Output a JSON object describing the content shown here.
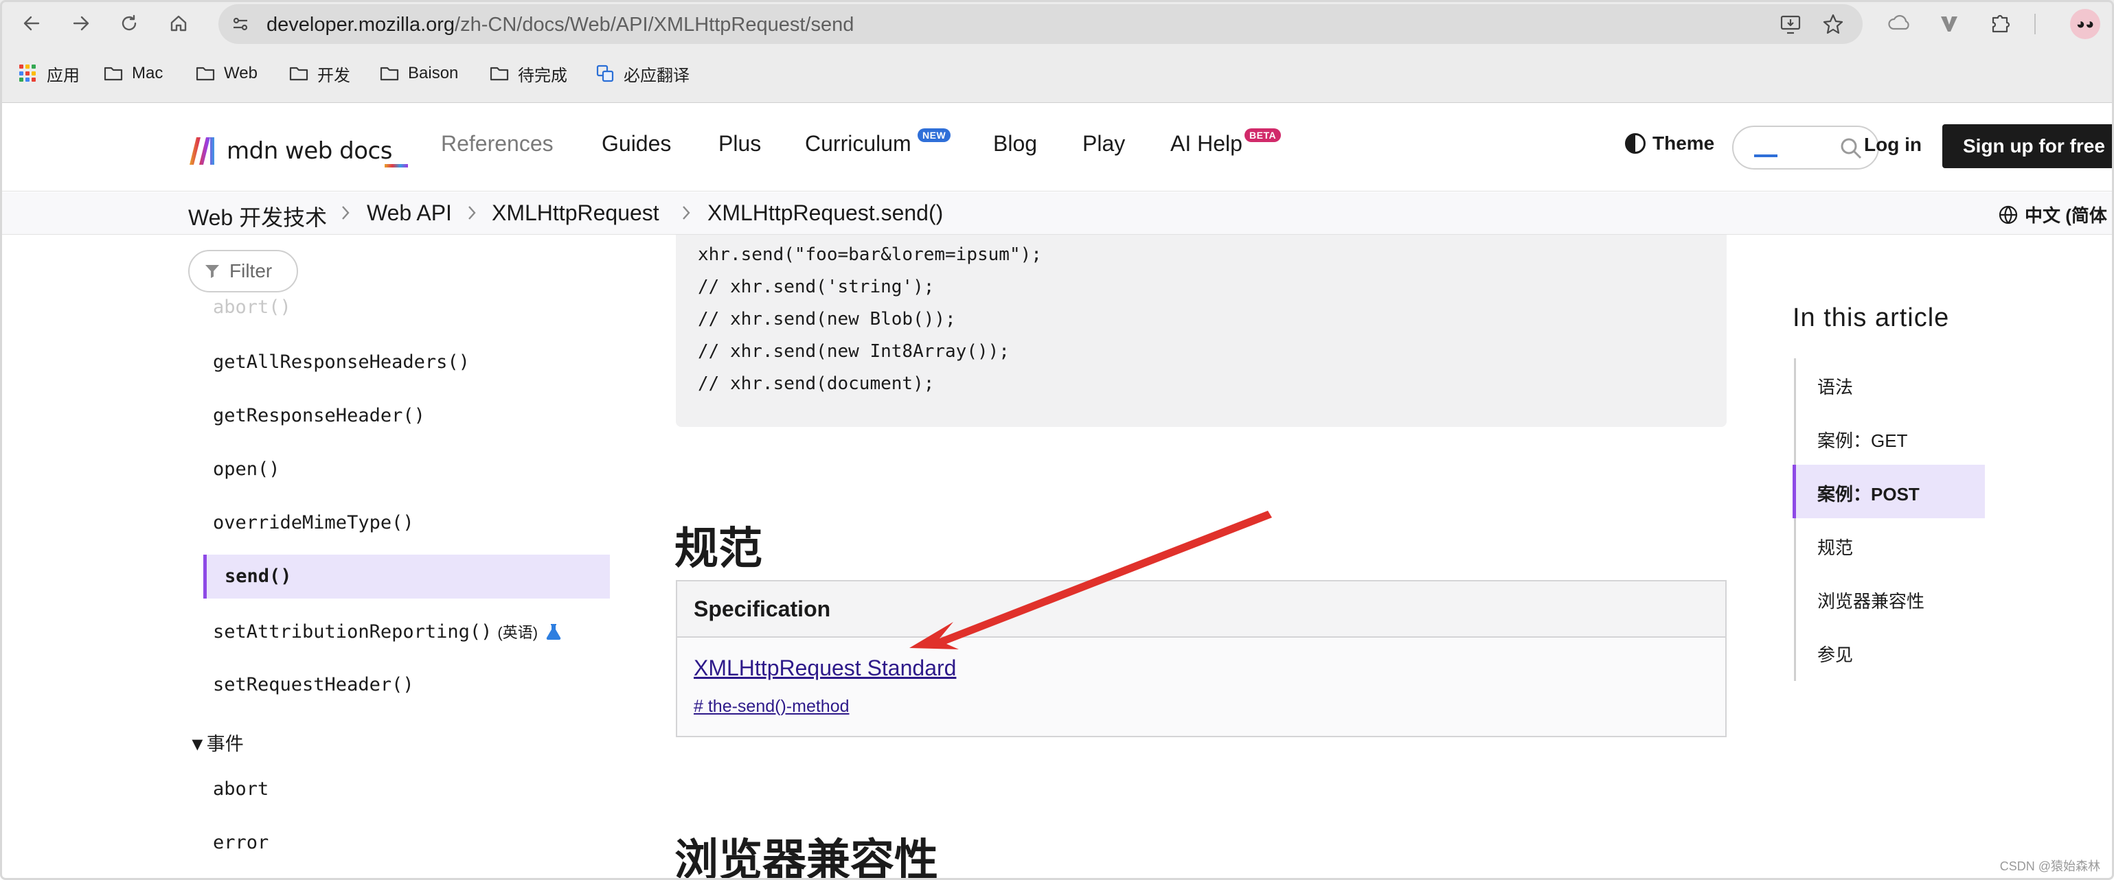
{
  "browser": {
    "url_host": "developer.mozilla.org",
    "url_path": "/zh-CN/docs/Web/API/XMLHttpRequest/send",
    "bookmarks": [
      {
        "label": "应用",
        "icon": "apps-grid-icon"
      },
      {
        "label": "Mac",
        "icon": "folder-icon"
      },
      {
        "label": "Web",
        "icon": "folder-icon"
      },
      {
        "label": "开发",
        "icon": "folder-icon"
      },
      {
        "label": "Baison",
        "icon": "folder-icon"
      },
      {
        "label": "待完成",
        "icon": "folder-icon"
      },
      {
        "label": "必应翻译",
        "icon": "bing-translate-icon"
      }
    ]
  },
  "header": {
    "logo_text": "mdn web docs",
    "nav": [
      {
        "label": "References"
      },
      {
        "label": "Guides"
      },
      {
        "label": "Plus"
      },
      {
        "label": "Curriculum",
        "tag": "NEW"
      },
      {
        "label": "Blog"
      },
      {
        "label": "Play"
      },
      {
        "label": "AI Help",
        "tag": "BETA"
      }
    ],
    "theme_label": "Theme",
    "login_label": "Log in",
    "signup_label": "Sign up for free"
  },
  "breadcrumb": {
    "items": [
      "Web 开发技术",
      "Web API",
      "XMLHttpRequest",
      "XMLHttpRequest.send()"
    ],
    "language": "中文 (简体"
  },
  "sidebar": {
    "filter_placeholder": "Filter",
    "faded_item": "abort()",
    "items": [
      "getAllResponseHeaders()",
      "getResponseHeader()",
      "open()",
      "overrideMimeType()"
    ],
    "active_item": "send()",
    "experimental_item": "setAttributionReporting()",
    "experimental_note": "(英语)",
    "after_items": [
      "setRequestHeader()"
    ],
    "group_label": "▼事件",
    "event_items": [
      "abort",
      "error"
    ]
  },
  "content": {
    "code_lines": [
      "xhr.send(\"foo=bar&lorem=ipsum\");",
      "// xhr.send('string');",
      "// xhr.send(new Blob());",
      "// xhr.send(new Int8Array());",
      "// xhr.send(document);"
    ],
    "spec_heading": "规范",
    "spec_table_header": "Specification",
    "spec_link": "XMLHttpRequest Standard",
    "spec_anchor": "# the-send()-method",
    "compat_heading": "浏览器兼容性"
  },
  "toc": {
    "title": "In this article",
    "items": [
      "语法",
      "案例：GET",
      "案例：POST",
      "规范",
      "浏览器兼容性",
      "参见"
    ],
    "active_index": 2
  },
  "watermark": "CSDN @猿始森林",
  "colors": {
    "accent_purple": "#8e4ae6",
    "active_bg": "#eae4fb",
    "link": "#2e1a8a",
    "annotation_arrow": "#e0312b",
    "tag_new": "#2f6fd8",
    "tag_beta": "#d12a6a"
  }
}
